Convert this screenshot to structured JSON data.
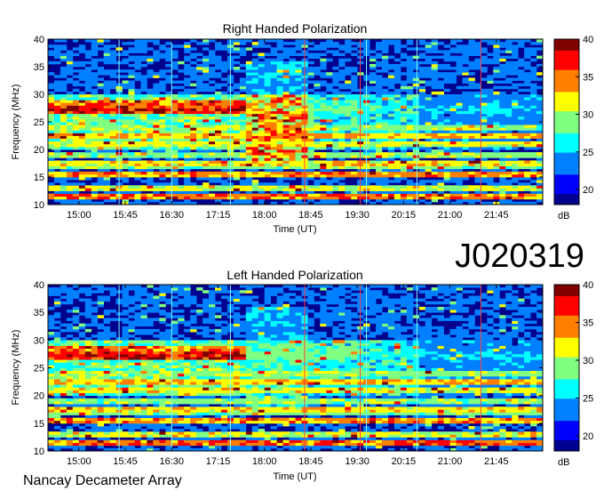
{
  "chart_data": [
    {
      "type": "heatmap",
      "title": "Right Handed Polarization",
      "xlabel": "Time (UT)",
      "ylabel": "Frequency (MHz)",
      "xticks": [
        "15:00",
        "15:45",
        "16:30",
        "17:15",
        "18:00",
        "18:45",
        "19:30",
        "20:15",
        "21:00",
        "21:45"
      ],
      "yticks": [
        "10",
        "15",
        "20",
        "25",
        "30",
        "35",
        "40"
      ],
      "xlim": [
        "14:30",
        "22:30"
      ],
      "ylim": [
        10,
        40
      ],
      "colorbar": {
        "label": "dB",
        "ticks": [
          "20",
          "25",
          "30",
          "35",
          "40"
        ],
        "range": [
          18,
          40
        ]
      }
    },
    {
      "type": "heatmap",
      "title": "Left Handed Polarization",
      "xlabel": "Time (UT)",
      "ylabel": "Frequency (MHz)",
      "xticks": [
        "15:00",
        "15:45",
        "16:30",
        "17:15",
        "18:00",
        "18:45",
        "19:30",
        "20:15",
        "21:00",
        "21:45"
      ],
      "yticks": [
        "10",
        "15",
        "20",
        "25",
        "30",
        "35",
        "40"
      ],
      "xlim": [
        "14:30",
        "22:30"
      ],
      "ylim": [
        10,
        40
      ],
      "colorbar": {
        "label": "dB",
        "ticks": [
          "20",
          "25",
          "30",
          "35",
          "40"
        ],
        "range": [
          18,
          40
        ]
      }
    }
  ],
  "observation_id": "J020319",
  "instrument": "Nancay Decameter Array",
  "colormap": [
    "#00008f",
    "#0000ff",
    "#0080ff",
    "#00ffff",
    "#80ff80",
    "#ffff00",
    "#ff8000",
    "#ff0000",
    "#800000"
  ]
}
